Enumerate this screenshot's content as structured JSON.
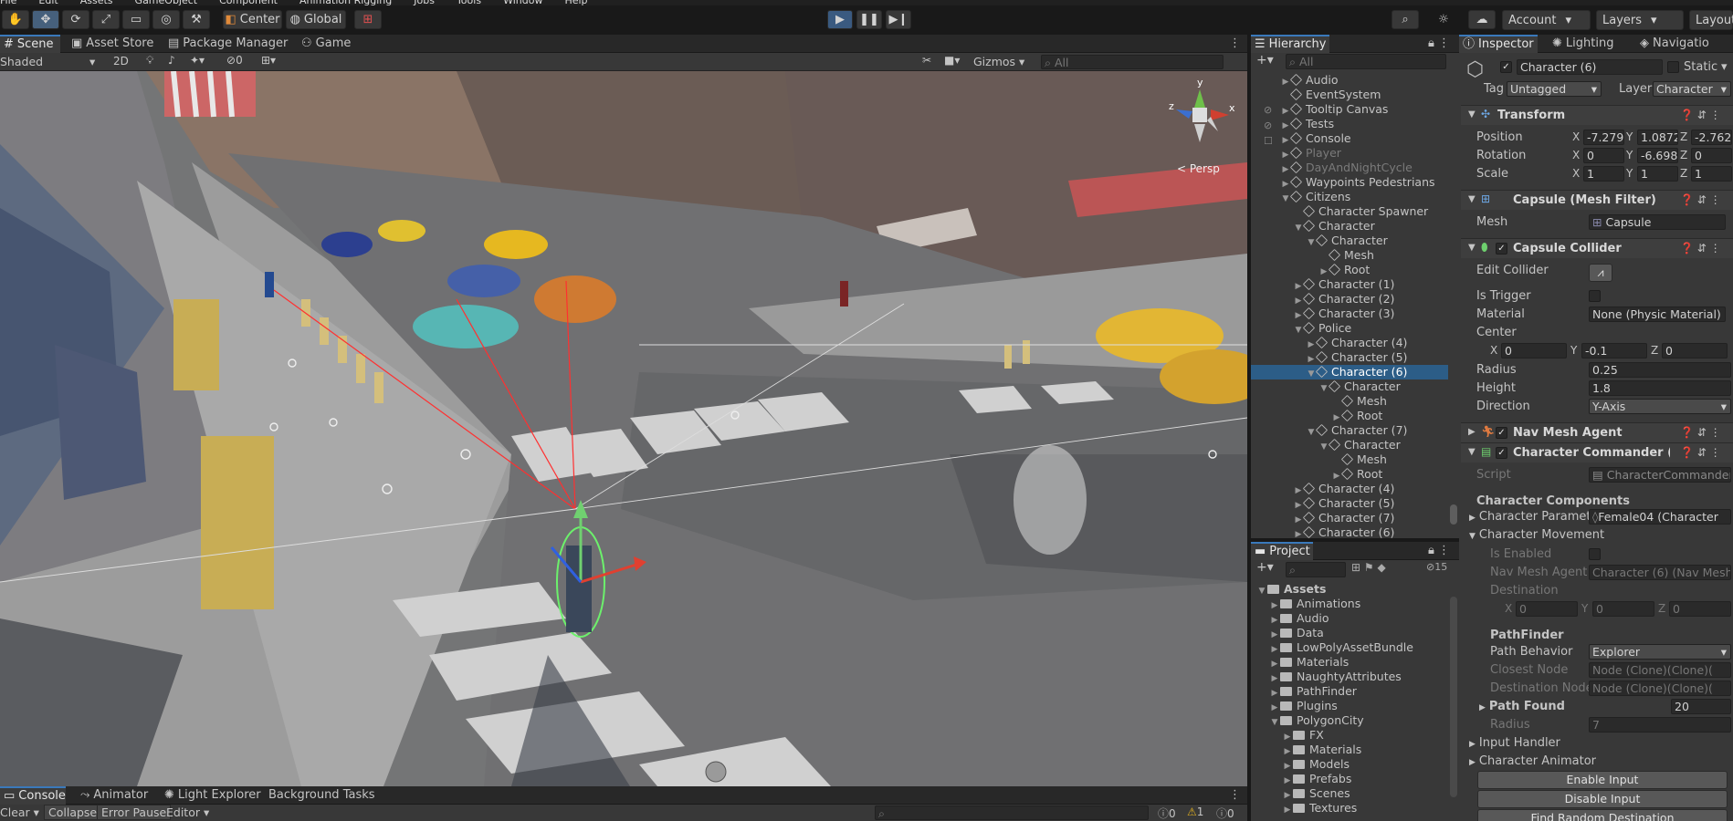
{
  "menu": [
    "File",
    "Edit",
    "Assets",
    "GameObject",
    "Component",
    "Animation Rigging",
    "Jobs",
    "Tools",
    "Window",
    "Help"
  ],
  "toolbar": {
    "pivot": "Center",
    "space": "Global",
    "account": "Account",
    "layers": "Layers",
    "layout": "Layout"
  },
  "scene_tabs": [
    "Scene",
    "Asset Store",
    "Package Manager",
    "Game"
  ],
  "scene_view": {
    "shading": "Shaded",
    "mode_2d": "2D",
    "hidden_count": "0",
    "gizmos": "Gizmos",
    "search_placeholder": "All",
    "persp": "< Persp",
    "axes": [
      "y",
      "x",
      "z"
    ]
  },
  "hierarchy": {
    "title": "Hierarchy",
    "search_placeholder": "All",
    "items": [
      {
        "label": "Audio",
        "indent": 1,
        "arrow": "▶",
        "state": ""
      },
      {
        "label": "EventSystem",
        "indent": 1,
        "arrow": "",
        "state": ""
      },
      {
        "label": "Tooltip Canvas",
        "indent": 1,
        "arrow": "▶",
        "state": ""
      },
      {
        "label": "Tests",
        "indent": 1,
        "arrow": "▶",
        "state": ""
      },
      {
        "label": "Console",
        "indent": 1,
        "arrow": "▶",
        "state": ""
      },
      {
        "label": "Player",
        "indent": 1,
        "arrow": "▶",
        "state": "dim"
      },
      {
        "label": "DayAndNightCycle",
        "indent": 1,
        "arrow": "▶",
        "state": "dim"
      },
      {
        "label": "Waypoints Pedestrians",
        "indent": 1,
        "arrow": "▶",
        "state": ""
      },
      {
        "label": "Citizens",
        "indent": 1,
        "arrow": "▼",
        "state": ""
      },
      {
        "label": "Character Spawner",
        "indent": 2,
        "arrow": "",
        "state": ""
      },
      {
        "label": "Character",
        "indent": 2,
        "arrow": "▼",
        "state": ""
      },
      {
        "label": "Character",
        "indent": 3,
        "arrow": "▼",
        "state": ""
      },
      {
        "label": "Mesh",
        "indent": 4,
        "arrow": "",
        "state": ""
      },
      {
        "label": "Root",
        "indent": 4,
        "arrow": "▶",
        "state": ""
      },
      {
        "label": "Character (1)",
        "indent": 2,
        "arrow": "▶",
        "state": ""
      },
      {
        "label": "Character (2)",
        "indent": 2,
        "arrow": "▶",
        "state": ""
      },
      {
        "label": "Character (3)",
        "indent": 2,
        "arrow": "▶",
        "state": ""
      },
      {
        "label": "Police",
        "indent": 2,
        "arrow": "▼",
        "state": ""
      },
      {
        "label": "Character (4)",
        "indent": 3,
        "arrow": "▶",
        "state": ""
      },
      {
        "label": "Character (5)",
        "indent": 3,
        "arrow": "▶",
        "state": ""
      },
      {
        "label": "Character (6)",
        "indent": 3,
        "arrow": "▼",
        "state": "sel"
      },
      {
        "label": "Character",
        "indent": 4,
        "arrow": "▼",
        "state": ""
      },
      {
        "label": "Mesh",
        "indent": 5,
        "arrow": "",
        "state": ""
      },
      {
        "label": "Root",
        "indent": 5,
        "arrow": "▶",
        "state": ""
      },
      {
        "label": "Character (7)",
        "indent": 3,
        "arrow": "▼",
        "state": ""
      },
      {
        "label": "Character",
        "indent": 4,
        "arrow": "▼",
        "state": ""
      },
      {
        "label": "Mesh",
        "indent": 5,
        "arrow": "",
        "state": ""
      },
      {
        "label": "Root",
        "indent": 5,
        "arrow": "▶",
        "state": ""
      },
      {
        "label": "Character (4)",
        "indent": 2,
        "arrow": "▶",
        "state": ""
      },
      {
        "label": "Character (5)",
        "indent": 2,
        "arrow": "▶",
        "state": ""
      },
      {
        "label": "Character (7)",
        "indent": 2,
        "arrow": "▶",
        "state": ""
      },
      {
        "label": "Character (6)",
        "indent": 2,
        "arrow": "▶",
        "state": ""
      }
    ]
  },
  "project": {
    "title": "Project",
    "hidden_count": "15",
    "items": [
      {
        "label": "Assets",
        "indent": 0,
        "arrow": "▼",
        "bold": true
      },
      {
        "label": "Animations",
        "indent": 1,
        "arrow": "▶"
      },
      {
        "label": "Audio",
        "indent": 1,
        "arrow": "▶"
      },
      {
        "label": "Data",
        "indent": 1,
        "arrow": "▶"
      },
      {
        "label": "LowPolyAssetBundle",
        "indent": 1,
        "arrow": "▶"
      },
      {
        "label": "Materials",
        "indent": 1,
        "arrow": "▶"
      },
      {
        "label": "NaughtyAttributes",
        "indent": 1,
        "arrow": "▶"
      },
      {
        "label": "PathFinder",
        "indent": 1,
        "arrow": "▶"
      },
      {
        "label": "Plugins",
        "indent": 1,
        "arrow": "▶"
      },
      {
        "label": "PolygonCity",
        "indent": 1,
        "arrow": "▼"
      },
      {
        "label": "FX",
        "indent": 2,
        "arrow": "▶"
      },
      {
        "label": "Materials",
        "indent": 2,
        "arrow": "▶"
      },
      {
        "label": "Models",
        "indent": 2,
        "arrow": "▶"
      },
      {
        "label": "Prefabs",
        "indent": 2,
        "arrow": "▶"
      },
      {
        "label": "Scenes",
        "indent": 2,
        "arrow": "▶"
      },
      {
        "label": "Textures",
        "indent": 2,
        "arrow": "▶"
      }
    ]
  },
  "inspector_tabs": [
    "Inspector",
    "Lighting",
    "Navigatio"
  ],
  "inspector": {
    "object_name": "Character (6)",
    "static": "Static",
    "tag_label": "Tag",
    "tag": "Untagged",
    "layer_label": "Layer",
    "layer": "Character",
    "transform": {
      "title": "Transform",
      "position_label": "Position",
      "rotation_label": "Rotation",
      "scale_label": "Scale",
      "position": [
        "-7.279",
        "1.0872",
        "-2.762"
      ],
      "rotation": [
        "0",
        "-6.698",
        "0"
      ],
      "scale": [
        "1",
        "1",
        "1"
      ]
    },
    "mesh_filter": {
      "title": "Capsule (Mesh Filter)",
      "mesh_label": "Mesh",
      "mesh": "Capsule"
    },
    "collider": {
      "title": "Capsule Collider",
      "edit_label": "Edit Collider",
      "trigger_label": "Is Trigger",
      "material_label": "Material",
      "material": "None (Physic Material)",
      "center_label": "Center",
      "center": [
        "0",
        "-0.1",
        "0"
      ],
      "radius_label": "Radius",
      "radius": "0.25",
      "height_label": "Height",
      "height": "1.8",
      "direction_label": "Direction",
      "direction": "Y-Axis"
    },
    "nav_agent": {
      "title": "Nav Mesh Agent"
    },
    "commander": {
      "title": "Character Commander (Script)",
      "script_label": "Script",
      "script": "CharacterCommander",
      "components_label": "Character Components",
      "params_label": "Character Parameters",
      "params": "Female04 (Character",
      "movement_label": "Character Movement",
      "enabled_label": "Is Enabled",
      "agent_label": "Nav Mesh Agent",
      "agent": "Character (6) (Nav Mesh",
      "destination_label": "Destination",
      "destination": [
        "0",
        "0",
        "0"
      ],
      "pathfinder_label": "PathFinder",
      "behavior_label": "Path Behavior",
      "behavior": "Explorer",
      "closest_label": "Closest Node",
      "closest": "Node (Clone)(Clone)(",
      "dest_node_label": "Destination Node",
      "dest_node": "Node (Clone)(Clone)(",
      "path_found_label": "Path Found",
      "path_found": "20",
      "radius_label": "Radius",
      "radius": "7",
      "input_label": "Input Handler",
      "animator_label": "Character Animator",
      "buttons": [
        "Enable Input",
        "Disable Input",
        "Find Random Destination"
      ]
    }
  },
  "bottom": {
    "tabs": [
      "Console",
      "Animator",
      "Light Explorer",
      "Background Tasks"
    ],
    "clear": "Clear",
    "collapse": "Collapse",
    "error_pause": "Error Pause",
    "editor": "Editor",
    "counts": [
      "0",
      "1",
      "0"
    ]
  }
}
